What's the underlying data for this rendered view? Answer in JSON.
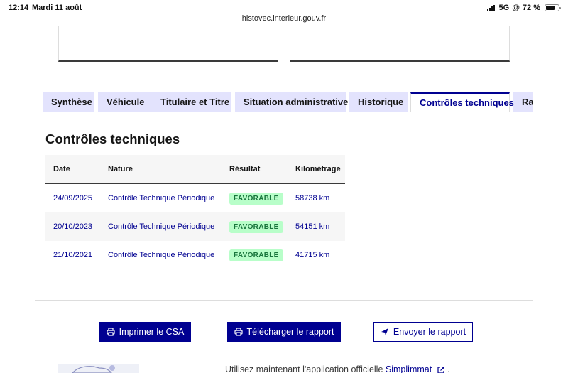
{
  "status_bar": {
    "time": "12:14",
    "date": "Mardi 11 août",
    "network": "5G",
    "battery": "72 %",
    "battery_level": 0.72
  },
  "browser": {
    "url": "histovec.interieur.gouv.fr"
  },
  "tabs": [
    {
      "label": "Synthèse",
      "active": false
    },
    {
      "label": "Véhicule",
      "active": false
    },
    {
      "label": "Titulaire et Titre",
      "active": false
    },
    {
      "label": "Situation administrative",
      "active": false
    },
    {
      "label": "Historique",
      "active": false
    },
    {
      "label": "Contrôles techniques",
      "active": true
    },
    {
      "label": "Rapport",
      "active": false
    }
  ],
  "panel": {
    "title": "Contrôles techniques",
    "table": {
      "headers": {
        "date": "Date",
        "nature": "Nature",
        "result": "Résultat",
        "km": "Kilométrage"
      },
      "rows": [
        {
          "date": "24/09/2025",
          "nature": "Contrôle Technique Périodique",
          "result": "FAVORABLE",
          "km": "58738 km"
        },
        {
          "date": "20/10/2023",
          "nature": "Contrôle Technique Périodique",
          "result": "FAVORABLE",
          "km": "54151 km"
        },
        {
          "date": "21/10/2021",
          "nature": "Contrôle Technique Périodique",
          "result": "FAVORABLE",
          "km": "41715 km"
        }
      ]
    }
  },
  "actions": {
    "print": "Imprimer le CSA",
    "download": "Télécharger le rapport",
    "send": "Envoyer le rapport"
  },
  "promo": {
    "text": "Utilisez maintenant l'application officielle",
    "link": "Simplimmat",
    "suffix": "."
  },
  "colors": {
    "primary": "#000091",
    "tab_bg": "#e3e3fd",
    "badge_bg": "#b8fec9",
    "badge_text": "#18753c"
  }
}
